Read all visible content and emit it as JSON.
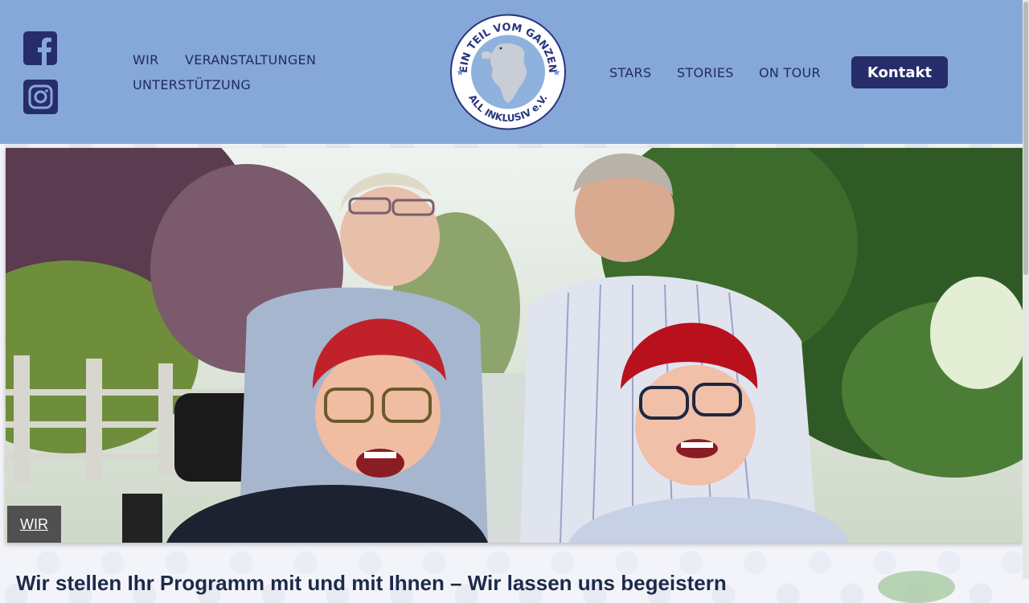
{
  "header": {
    "nav_left": [
      "WIR",
      "VERANSTALTUNGEN",
      "UNTERSTÜTZUNG"
    ],
    "nav_right": [
      "STARS",
      "STORIES",
      "ON TOUR"
    ],
    "kontakt_label": "Kontakt",
    "logo": {
      "top_text": "EIN TEIL VOM GANZEN",
      "bottom_text": "ALL INKLUSIV e.V."
    },
    "social": [
      "facebook-icon",
      "instagram-icon"
    ]
  },
  "hero": {
    "label": "WIR"
  },
  "section": {
    "heading": "Wir stellen Ihr Programm mit und mit Ihnen – Wir lassen uns begeistern"
  },
  "colors": {
    "header_bg": "#85a8d9",
    "nav_text": "#232a62",
    "button_bg": "#262d6a",
    "label_bg": "#505050"
  }
}
